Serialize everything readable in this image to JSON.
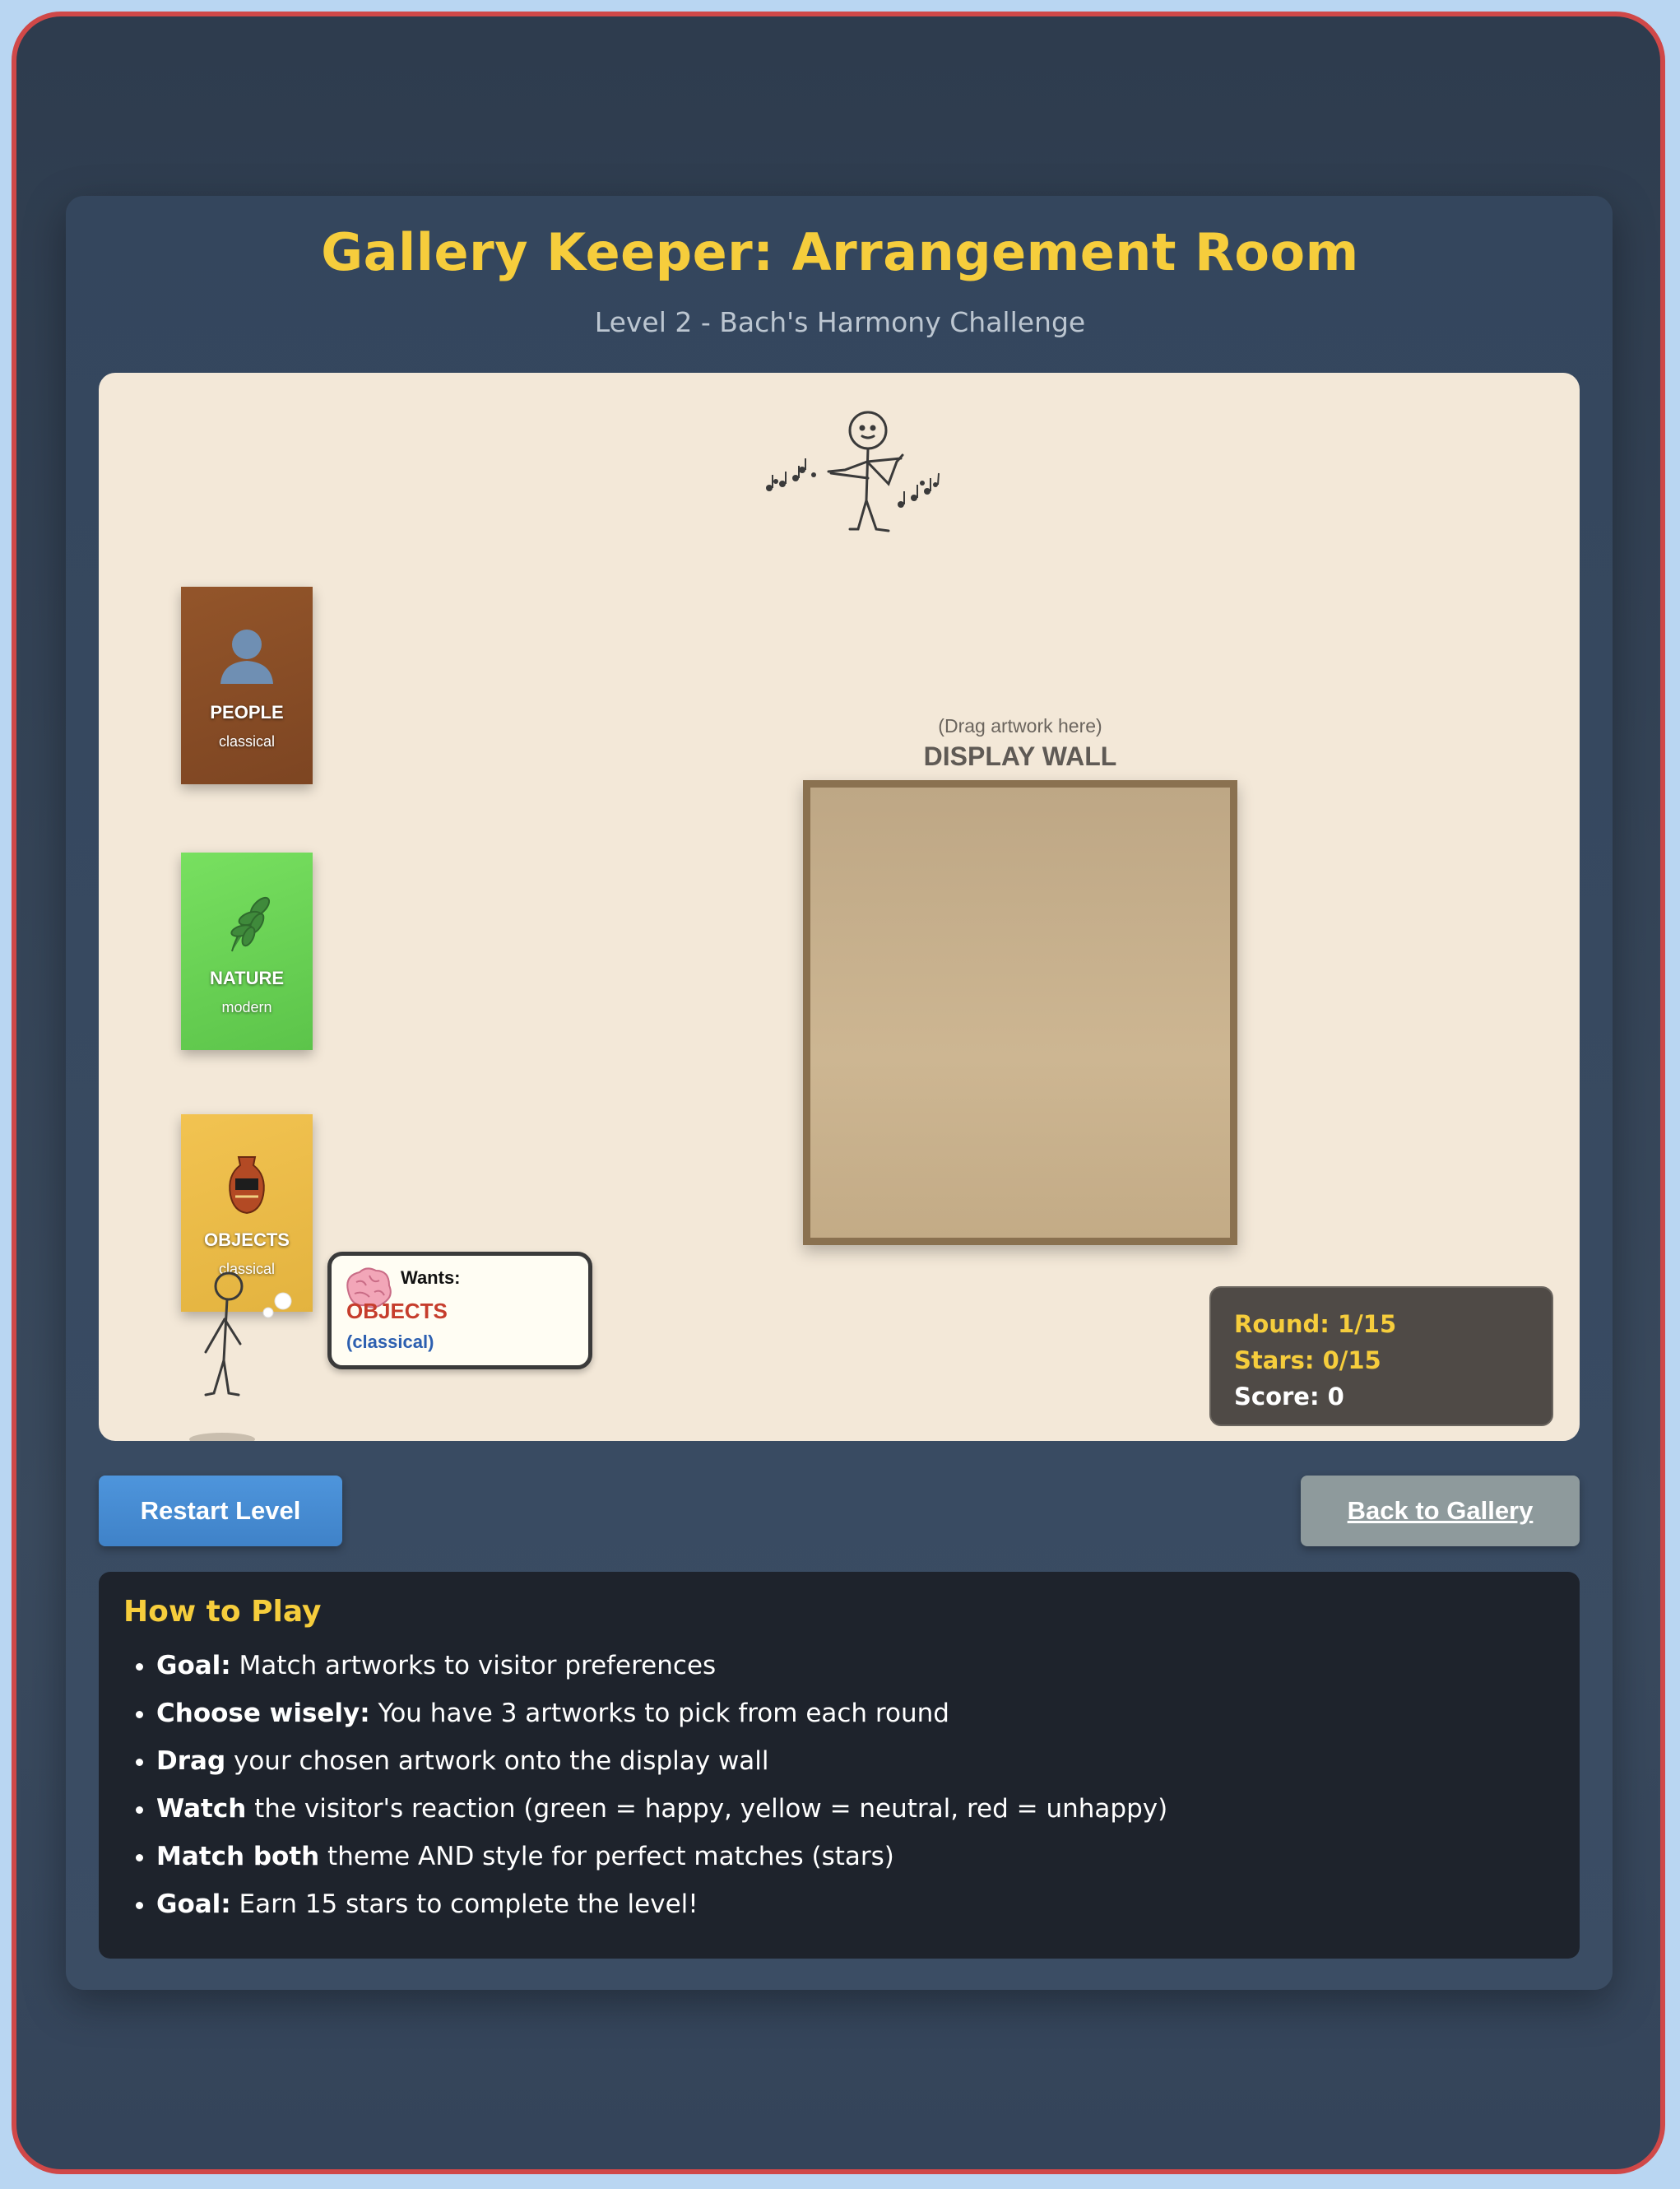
{
  "header": {
    "title": "Gallery Keeper: Arrangement Room",
    "subtitle": "Level 2 - Bach's Harmony Challenge"
  },
  "artworks": [
    {
      "theme": "PEOPLE",
      "style": "classical",
      "icon": "person-icon",
      "color": "#8b4f27"
    },
    {
      "theme": "NATURE",
      "style": "modern",
      "icon": "leaf-icon",
      "color": "#6cd456"
    },
    {
      "theme": "OBJECTS",
      "style": "classical",
      "icon": "vase-icon",
      "color": "#ebbb48"
    }
  ],
  "display_wall": {
    "hint": "(Drag artwork here)",
    "label": "DISPLAY WALL"
  },
  "visitor": {
    "wants_label": "Wants:",
    "theme": "OBJECTS",
    "style": "(classical)",
    "icon": "brain-icon"
  },
  "musician": {
    "icon": "violinist-stick-figure"
  },
  "status": {
    "round": "Round: 1/15",
    "stars": "Stars: 0/15",
    "score": "Score: 0"
  },
  "buttons": {
    "restart": "Restart Level",
    "back": "Back to Gallery"
  },
  "howto": {
    "title": "How to Play",
    "items": [
      {
        "bold": "Goal:",
        "text": " Match artworks to visitor preferences"
      },
      {
        "bold": "Choose wisely:",
        "text": " You have 3 artworks to pick from each round"
      },
      {
        "bold": "Drag",
        "text": " your chosen artwork onto the display wall"
      },
      {
        "bold": "Watch",
        "text": " the visitor's reaction (green = happy, yellow = neutral, red = unhappy)"
      },
      {
        "bold": "Match both",
        "text": " theme AND style for perfect matches (stars)"
      },
      {
        "bold": "Goal:",
        "text": " Earn 15 stars to complete the level!"
      }
    ]
  },
  "colors": {
    "accent": "#f6cd3c",
    "frame_border": "#d04848",
    "restart_button": "#4a8fd6",
    "back_button": "#8e9a9c"
  }
}
